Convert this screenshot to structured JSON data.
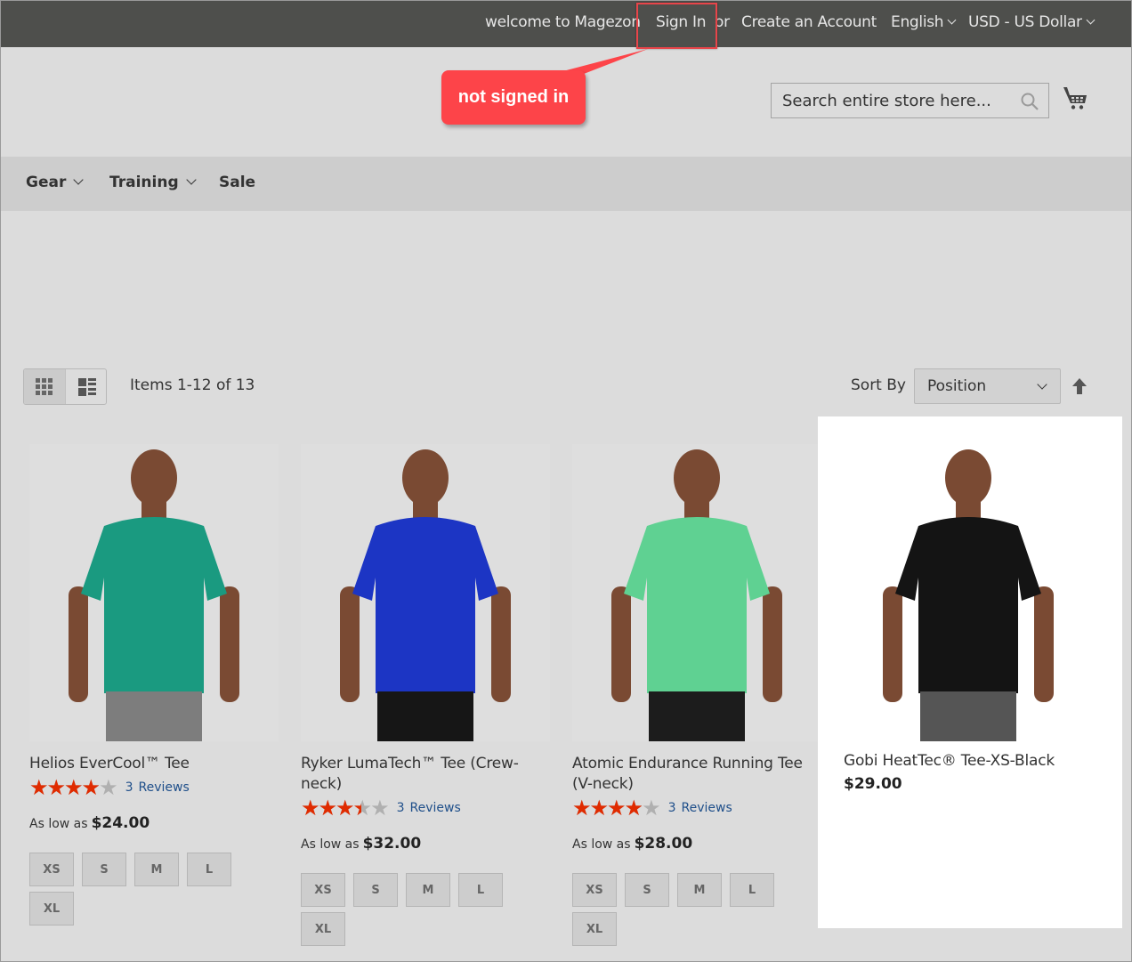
{
  "topbar": {
    "welcome": "welcome to Magezon",
    "sign_in": "Sign In",
    "or": "or",
    "create_account": "Create an Account",
    "language": "English",
    "currency": "USD - US Dollar"
  },
  "annotation": {
    "callout_text": "not signed in",
    "highlight_color": "#e8454a",
    "callout_color": "#fd4449"
  },
  "header": {
    "search_placeholder": "Search entire store here...",
    "search_icon": "search-icon",
    "cart_icon": "shopping-cart-icon"
  },
  "nav": {
    "items": [
      {
        "label": "Gear",
        "has_dropdown": true
      },
      {
        "label": "Training",
        "has_dropdown": true
      },
      {
        "label": "Sale",
        "has_dropdown": false
      }
    ]
  },
  "toolbar": {
    "view_modes": [
      {
        "name": "grid",
        "icon": "grid-icon",
        "active": true
      },
      {
        "name": "list",
        "icon": "list-icon",
        "active": false
      }
    ],
    "item_count": "Items 1-12 of 13",
    "sort_label": "Sort By",
    "sort_value": "Position",
    "sort_direction_icon": "arrow-up-icon"
  },
  "products": [
    {
      "name": "Helios EverCool™ Tee",
      "rating_percent": 80,
      "review_count": "3",
      "review_label": "Reviews",
      "price_label": "As low as",
      "price": "$24.00",
      "sizes": [
        "XS",
        "S",
        "M",
        "L",
        "XL"
      ],
      "shirt_color": "#1a9a80",
      "shorts_color": "#7d7d7d",
      "highlighted": false
    },
    {
      "name": "Ryker LumaTech™ Tee (Crew-neck)",
      "rating_percent": 70,
      "review_count": "3",
      "review_label": "Reviews",
      "price_label": "As low as",
      "price": "$32.00",
      "sizes": [
        "XS",
        "S",
        "M",
        "L",
        "XL"
      ],
      "shirt_color": "#1c35c4",
      "shorts_color": "#161616",
      "highlighted": false
    },
    {
      "name": "Atomic Endurance Running Tee (V-neck)",
      "rating_percent": 80,
      "review_count": "3",
      "review_label": "Reviews",
      "price_label": "As low as",
      "price": "$28.00",
      "sizes": [
        "XS",
        "S",
        "M",
        "L",
        "XL"
      ],
      "shirt_color": "#5fd192",
      "shorts_color": "#1c1c1c",
      "highlighted": false
    },
    {
      "name": "Gobi HeatTec® Tee-XS-Black",
      "price": "$29.00",
      "shirt_color": "#141414",
      "shorts_color": "#555555",
      "highlighted": true
    }
  ]
}
